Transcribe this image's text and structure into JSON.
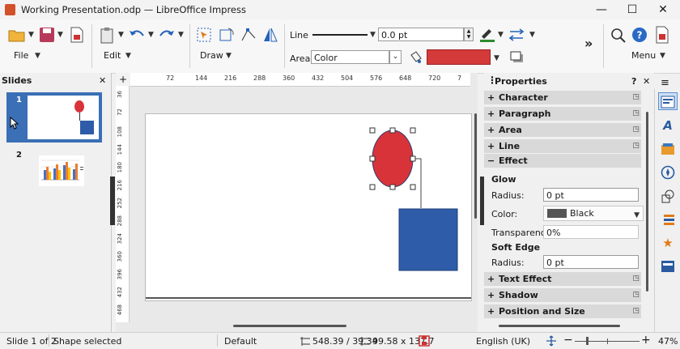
{
  "window": {
    "title": "Working Presentation.odp — LibreOffice Impress",
    "minimize": "—",
    "maximize": "☐",
    "close": "✕"
  },
  "toolbar": {
    "file_label": "File",
    "edit_label": "Edit",
    "draw_label": "Draw",
    "menu_label": "Menu",
    "line_label": "Line",
    "line_width": "0.0 pt",
    "area_label": "Area",
    "area_fill": "Color",
    "more": "»",
    "fill_color": "#d43a3a",
    "line_color": "#2e8b2e"
  },
  "slides_pane": {
    "title": "Slides",
    "close": "✕",
    "slides": [
      {
        "number": "1"
      },
      {
        "number": "2"
      }
    ]
  },
  "ruler": {
    "h_ticks": [
      "72",
      "144",
      "216",
      "288",
      "360",
      "432",
      "504",
      "576",
      "648",
      "720",
      "7"
    ],
    "v_ticks": [
      "36",
      "72",
      "108",
      "144",
      "180",
      "216",
      "252",
      "288",
      "324",
      "360",
      "396",
      "432",
      "468"
    ]
  },
  "sidebar": {
    "title": "Properties",
    "help": "?",
    "close": "✕",
    "menu": "≡",
    "sections_top": [
      {
        "label": "Character",
        "pm": "+"
      },
      {
        "label": "Paragraph",
        "pm": "+"
      },
      {
        "label": "Area",
        "pm": "+"
      },
      {
        "label": "Line",
        "pm": "+"
      }
    ],
    "effect": {
      "label": "Effect",
      "pm": "−",
      "glow_heading": "Glow",
      "glow_radius_label": "Radius:",
      "glow_radius": "0 pt",
      "glow_color_label": "Color:",
      "glow_color": "Black",
      "transparency_label": "Transparency:",
      "transparency": "0%",
      "soft_edge_heading": "Soft Edge",
      "soft_radius_label": "Radius:",
      "soft_radius": "0 pt"
    },
    "sections_bottom": [
      {
        "label": "Text Effect",
        "pm": "+"
      },
      {
        "label": "Shadow",
        "pm": "+"
      },
      {
        "label": "Position and Size",
        "pm": "+"
      }
    ]
  },
  "status": {
    "slide": "Slide 1 of 2",
    "selection": "Shape selected",
    "layout": "Default",
    "position": "548.39 / 39.34",
    "size": "99.58 x 137.7",
    "language": "English (UK)",
    "zoom": "47%"
  },
  "shapes": {
    "ellipse_color": "#d9333a",
    "rect_color": "#2f5ca8"
  }
}
